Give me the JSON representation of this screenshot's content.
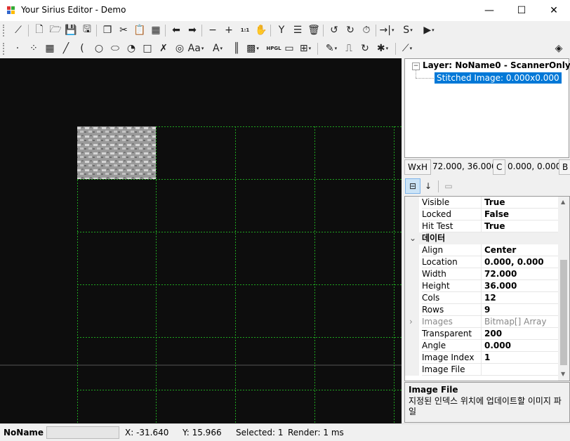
{
  "window": {
    "title": "Your Sirius Editor - Demo",
    "minimize": "—",
    "maximize": "☐",
    "close": "✕"
  },
  "toolbar1": [
    {
      "name": "ruler-icon",
      "glyph": "⟋"
    },
    {
      "name": "new-document-icon",
      "glyph": "🗋"
    },
    {
      "name": "open-folder-icon",
      "glyph": "🗁"
    },
    {
      "name": "save-icon",
      "glyph": "💾"
    },
    {
      "name": "save-as-icon",
      "glyph": "🖫"
    },
    {
      "name": "copy-icon",
      "glyph": "❐"
    },
    {
      "name": "cut-icon",
      "glyph": "✂"
    },
    {
      "name": "paste-icon",
      "glyph": "📋"
    },
    {
      "name": "paste-array-icon",
      "glyph": "▦"
    },
    {
      "name": "undo-icon",
      "glyph": "⬅"
    },
    {
      "name": "redo-icon",
      "glyph": "➡"
    },
    {
      "name": "zoom-out-icon",
      "glyph": "−"
    },
    {
      "name": "zoom-in-icon",
      "glyph": "+"
    },
    {
      "name": "zoom-1to1-icon",
      "glyph": "1:1"
    },
    {
      "name": "pan-hand-icon",
      "glyph": "✋"
    },
    {
      "name": "group-icon",
      "glyph": "Y"
    },
    {
      "name": "list-icon",
      "glyph": "☰"
    },
    {
      "name": "delete-icon",
      "glyph": "🗑"
    },
    {
      "name": "rotate-ccw-icon",
      "glyph": "↺"
    },
    {
      "name": "rotate-cw-icon",
      "glyph": "↻"
    },
    {
      "name": "timer-icon",
      "glyph": "⏱"
    },
    {
      "name": "align-dropdown-icon",
      "glyph": "→|"
    },
    {
      "name": "transform-dropdown-icon",
      "glyph": "S"
    },
    {
      "name": "play-dropdown-icon",
      "glyph": "▶"
    }
  ],
  "toolbar2": [
    {
      "name": "point-icon",
      "glyph": "·"
    },
    {
      "name": "points-icon",
      "glyph": "⁘"
    },
    {
      "name": "raster-icon",
      "glyph": "▦"
    },
    {
      "name": "line-icon",
      "glyph": "╱"
    },
    {
      "name": "arc-icon",
      "glyph": "("
    },
    {
      "name": "circle-icon",
      "glyph": "○"
    },
    {
      "name": "ellipse-icon",
      "glyph": "⬭"
    },
    {
      "name": "trepan-icon",
      "glyph": "◔"
    },
    {
      "name": "rectangle-icon",
      "glyph": "□"
    },
    {
      "name": "curve-icon",
      "glyph": "✗"
    },
    {
      "name": "spiral-icon",
      "glyph": "◎"
    },
    {
      "name": "text-dropdown-icon",
      "glyph": "Aa"
    },
    {
      "name": "font-text-dropdown-icon",
      "glyph": "A"
    },
    {
      "name": "barcode-icon",
      "glyph": "║"
    },
    {
      "name": "qrcode-dropdown-icon",
      "glyph": "▩"
    },
    {
      "name": "hpgl-icon",
      "glyph": "HPGL"
    },
    {
      "name": "image-icon",
      "glyph": "▭"
    },
    {
      "name": "grid-dropdown-icon",
      "glyph": "⊞"
    },
    {
      "name": "pen-dropdown-icon",
      "glyph": "✎"
    },
    {
      "name": "pulse-icon",
      "glyph": "⎍"
    },
    {
      "name": "rotation-icon",
      "glyph": "↻"
    },
    {
      "name": "laser-dropdown-icon",
      "glyph": "✱"
    },
    {
      "name": "chart-dropdown-icon",
      "glyph": "⟋"
    },
    {
      "name": "layers-icon",
      "glyph": "◈"
    }
  ],
  "tree": {
    "layer": "Layer: NoName0 - ScannerOnly",
    "item": "Stitched Image: 0.000x0.000",
    "expander": "−"
  },
  "wxh": {
    "label": "WxH",
    "value": "72.000, 36.000",
    "c_label": "C",
    "c_value": "0.000, 0.000",
    "b_label": "B"
  },
  "props": {
    "rows": [
      {
        "name": "Visible",
        "value": "True"
      },
      {
        "name": "Locked",
        "value": "False"
      },
      {
        "name": "Hit Test",
        "value": "True"
      }
    ],
    "category": "데이터",
    "rows2": [
      {
        "name": "Align",
        "value": "Center"
      },
      {
        "name": "Location",
        "value": "0.000, 0.000"
      },
      {
        "name": "Width",
        "value": "72.000"
      },
      {
        "name": "Height",
        "value": "36.000"
      },
      {
        "name": "Cols",
        "value": "12"
      },
      {
        "name": "Rows",
        "value": "9"
      },
      {
        "name": "Images",
        "value": "Bitmap[] Array"
      },
      {
        "name": "Transparent",
        "value": "200"
      },
      {
        "name": "Angle",
        "value": "0.000"
      },
      {
        "name": "Image Index",
        "value": "1"
      },
      {
        "name": "Image File",
        "value": ""
      }
    ]
  },
  "description": {
    "title": "Image File",
    "text": "지정된 인덱스 위치에 업데이트할 이미지 파일"
  },
  "status": {
    "name": "NoName",
    "x": "X: -31.640",
    "y": "Y: 15.966",
    "selected": "Selected: 1",
    "render": "Render: 1 ms"
  },
  "colors": {
    "selection": "#0078d7",
    "guide": "#1fa51f",
    "canvas": "#0d0d0d"
  }
}
